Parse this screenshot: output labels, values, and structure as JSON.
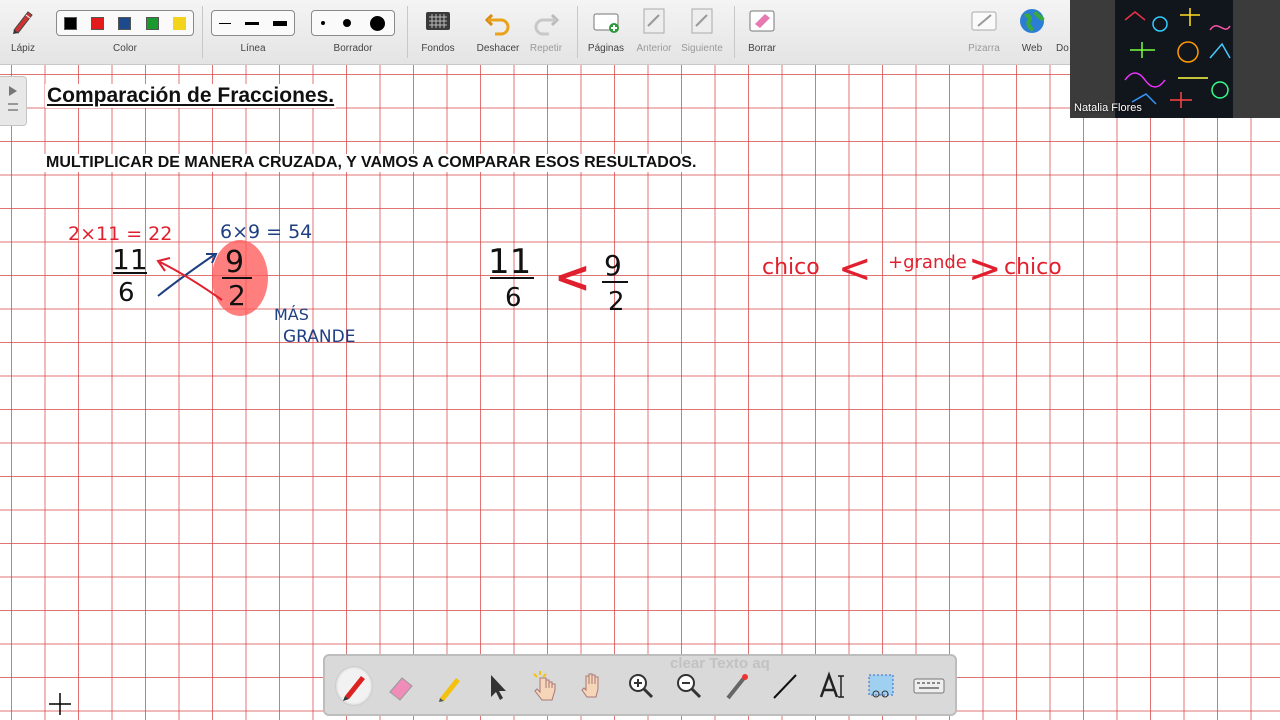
{
  "toolbar": {
    "pencil": "Lápiz",
    "color": "Color",
    "line": "Línea",
    "eraser": "Borrador",
    "backgrounds": "Fondos",
    "undo": "Deshacer",
    "redo": "Repetir",
    "pages": "Páginas",
    "previous": "Anterior",
    "next": "Siguiente",
    "clear": "Borrar",
    "board": "Pizarra",
    "web": "Web",
    "docs_partial": "Do"
  },
  "colors": {
    "black": "#000000",
    "red": "#e31b1b",
    "blue": "#1c4a8c",
    "green": "#1a9a2e",
    "yellow": "#f3d31c",
    "ink_red": "#e0202e",
    "ink_blue": "#1e3f82",
    "grid": "#d64646"
  },
  "canvas": {
    "title": "Comparación de Fracciones.",
    "instruction": "MULTIPLICAR DE MANERA CRUZADA, Y VAMOS A COMPARAR ESOS RESULTADOS."
  },
  "handwriting": {
    "red_product": "2×11 = 22",
    "blue_product": "6×9 = 54",
    "frac1_num": "11",
    "frac1_den": "6",
    "frac2_num": "9",
    "frac2_den": "2",
    "mas": "MÁS",
    "grande": "GRANDE",
    "result_num1": "11",
    "result_den1": "6",
    "comparison_sign": "<",
    "result_num2": "9",
    "result_den2": "2",
    "rule_left": "chico",
    "rule_lt": "<",
    "rule_mid": "+grande",
    "rule_gt": ">",
    "rule_right": "chico"
  },
  "webcam": {
    "participant": "Natalia Flores"
  },
  "bottom_toolbar": {
    "ghost_text": "clear Texto aq"
  }
}
